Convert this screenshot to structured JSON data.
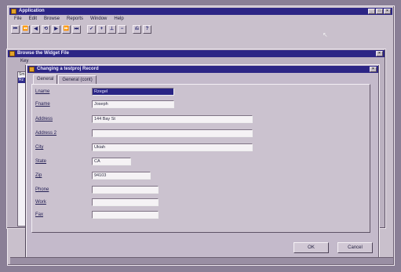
{
  "app": {
    "title": "Application",
    "menu": [
      "File",
      "Edit",
      "Browse",
      "Reports",
      "Window",
      "Help"
    ],
    "toolbar": [
      "⏮",
      "⏪",
      "◀",
      "⟲",
      "▶",
      "⏩",
      "⏭",
      "✓",
      "+",
      "⊥",
      "−",
      "⎌",
      "?"
    ]
  },
  "browse_window": {
    "title": "Browse the Widget File",
    "tab_label": "Key"
  },
  "dialog": {
    "title": "Changing a testproj Record",
    "tabs": [
      "General",
      "General (cont)"
    ],
    "fields": [
      {
        "label": "Lname",
        "value": "Rzegel"
      },
      {
        "label": "Fname",
        "value": "Joseph"
      },
      {
        "label": "Address",
        "value": "144 Bay St"
      },
      {
        "label": "Address 2",
        "value": ""
      },
      {
        "label": "City",
        "value": "Ukiah"
      },
      {
        "label": "State",
        "value": "CA"
      },
      {
        "label": "Zip",
        "value": "94103"
      },
      {
        "label": "Phone",
        "value": ""
      },
      {
        "label": "Work",
        "value": ""
      },
      {
        "label": "Fax",
        "value": ""
      }
    ],
    "ok_label": "OK",
    "cancel_label": "Cancel"
  }
}
